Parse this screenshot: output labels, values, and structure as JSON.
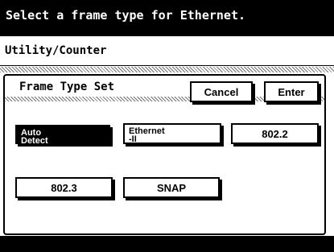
{
  "prompt": "Select a frame type for Ethernet.",
  "breadcrumb": "Utility/Counter",
  "panel": {
    "title": "Frame Type Set",
    "cancel_label": "Cancel",
    "enter_label": "Enter"
  },
  "options": {
    "auto_detect": {
      "line1": "Auto",
      "line2": "Detect"
    },
    "ethernet_ii": {
      "line1": "Ethernet",
      "line2": "-II"
    },
    "ieee_8022": "802.2",
    "ieee_8023": "802.3",
    "snap": "SNAP"
  },
  "selected_option": "Auto Detect"
}
